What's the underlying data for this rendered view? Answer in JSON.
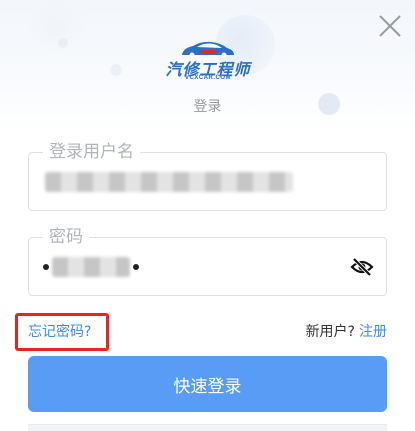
{
  "dialog": {
    "logo": {
      "brand_text": "汽修工程师",
      "domain_text": "VCXCAR.COM"
    },
    "subtitle": "登录",
    "close_icon": "close-icon",
    "username_field": {
      "label": "登录用户名",
      "value_masked": true
    },
    "password_field": {
      "label": "密码",
      "value_masked": true,
      "toggle_icon": "eye-slash-icon"
    },
    "forgot_password_label": "忘记密码?",
    "new_user_text": "新用户?",
    "register_label": "注册",
    "login_button_label": "快速登录",
    "colors": {
      "accent": "#3b8cf0",
      "primary_button": "#589cf6",
      "highlight_box": "#e8241d",
      "field_border": "#dcdfe6",
      "label_gray": "#b0b4bb"
    }
  }
}
